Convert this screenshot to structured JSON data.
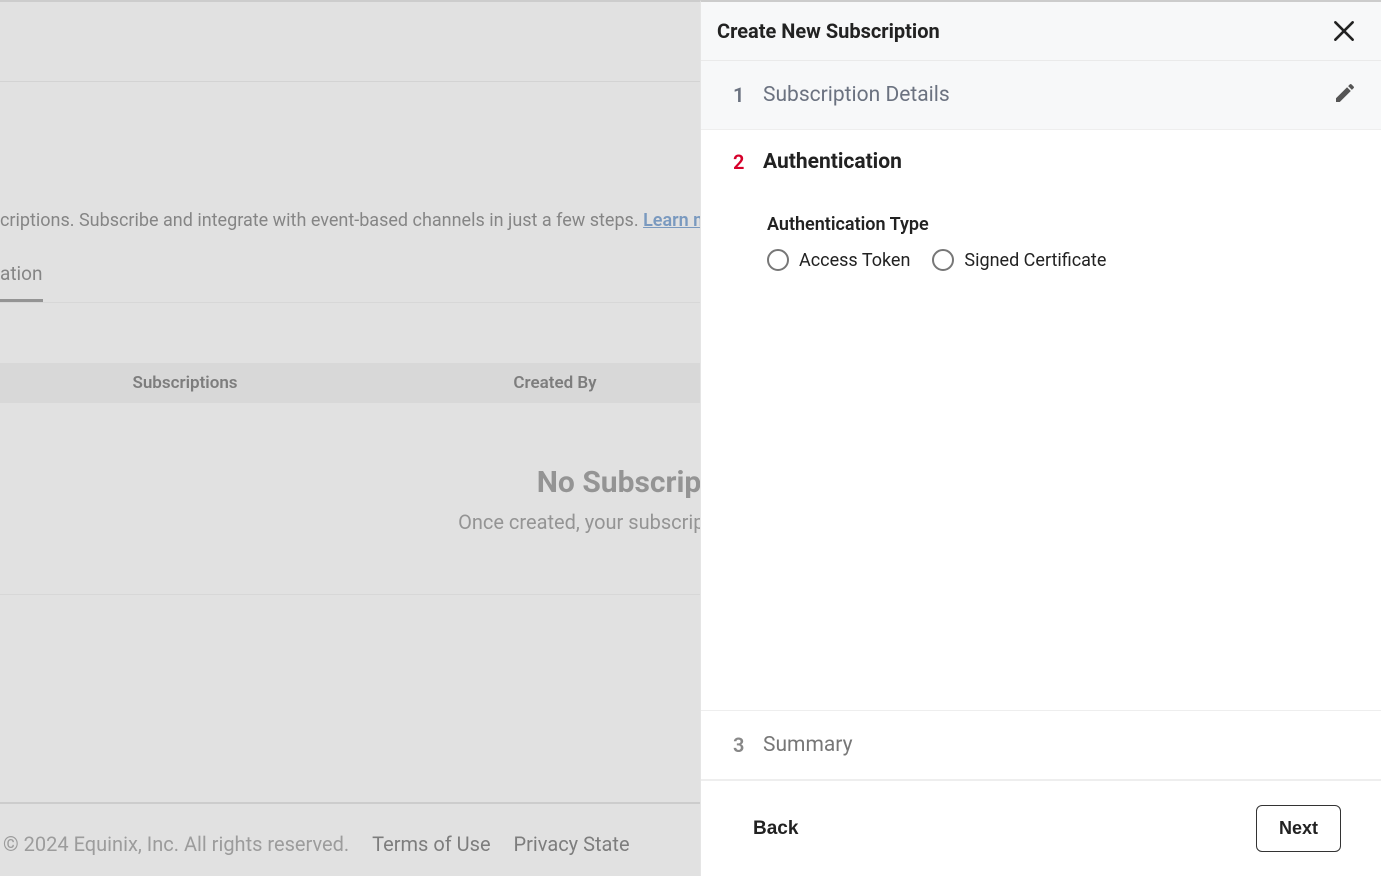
{
  "background": {
    "description": "criptions. Subscribe and integrate with event-based channels in just a few steps. ",
    "learn_more": "Learn more",
    "tab_label": "ation",
    "table": {
      "col_subscriptions": "Subscriptions",
      "col_created_by": "Created By"
    },
    "empty_title": "No Subscription Found",
    "empty_subtitle": "Once created, your subscriptions will be shown here.",
    "footer": {
      "copyright": "© 2024 Equinix, Inc. All rights reserved.",
      "terms": "Terms of Use",
      "privacy": "Privacy State"
    }
  },
  "panel": {
    "title": "Create New Subscription",
    "steps": {
      "s1": {
        "num": "1",
        "label": "Subscription Details"
      },
      "s2": {
        "num": "2",
        "label": "Authentication"
      },
      "s3": {
        "num": "3",
        "label": "Summary"
      }
    },
    "auth": {
      "type_label": "Authentication Type",
      "option_access_token": "Access Token",
      "option_signed_cert": "Signed Certificate"
    },
    "footer": {
      "back": "Back",
      "next": "Next"
    }
  }
}
